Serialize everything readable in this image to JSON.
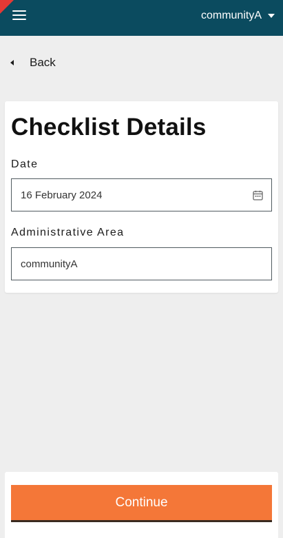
{
  "header": {
    "menu_icon": "hamburger-menu-icon",
    "user": "communityA",
    "dropdown_icon": "caret-down-icon",
    "background_color": "#0b4b5f",
    "ribbon_color": "#e53935"
  },
  "nav": {
    "back_label": "Back",
    "back_icon": "caret-left-icon"
  },
  "form": {
    "title": "Checklist Details",
    "date": {
      "label": "Date",
      "value": "16 February 2024",
      "icon": "calendar-icon"
    },
    "area": {
      "label": "Administrative Area",
      "value": "communityA"
    }
  },
  "footer": {
    "continue_label": "Continue",
    "button_color": "#f47738"
  }
}
